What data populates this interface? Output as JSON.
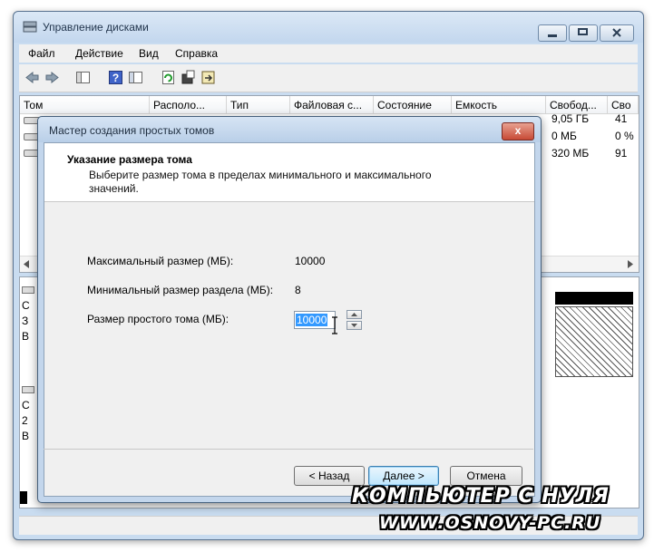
{
  "window": {
    "title": "Управление дисками",
    "icon": "disk-management-icon"
  },
  "menu": [
    "Файл",
    "Действие",
    "Вид",
    "Справка"
  ],
  "toolbar": {
    "icons": [
      "back-arrow-icon",
      "forward-arrow-icon",
      "view-panel-icon",
      "help-icon",
      "properties-icon",
      "refresh-icon",
      "rescan-icon",
      "export-icon"
    ],
    "help_glyph": "?"
  },
  "volume_list": {
    "columns": [
      "Том",
      "Располо...",
      "Тип",
      "Файловая с...",
      "Состояние",
      "Емкость",
      "Свобод...",
      "Сво"
    ],
    "rows": [
      {
        "free": "9,05 ГБ",
        "pct": "41"
      },
      {
        "free": "0 МБ",
        "pct": "0 %"
      },
      {
        "free": "320 МБ",
        "pct": "91"
      }
    ]
  },
  "lower_panel": {
    "disk0_letters": [
      "С",
      "З",
      "В"
    ],
    "disk1_letters": [
      "С",
      "2",
      "В"
    ]
  },
  "wizard": {
    "title": "Мастер создания простых томов",
    "close_glyph": "x",
    "header_title": "Указание размера тома",
    "header_desc": "Выберите размер тома в пределах минимального и максимального значений.",
    "max_label": "Максимальный размер (МБ):",
    "max_value": "10000",
    "min_label": "Минимальный размер раздела (МБ):",
    "min_value": "8",
    "size_label": "Размер простого тома (МБ):",
    "size_value": "10000",
    "back_button": "< Назад",
    "next_button": "Далее >",
    "cancel_button": "Отмена"
  },
  "watermark": {
    "line1": "КОМПЬЮТЕР С НУЛЯ",
    "line2": "WWW.OSNOVY-PC.RU"
  }
}
